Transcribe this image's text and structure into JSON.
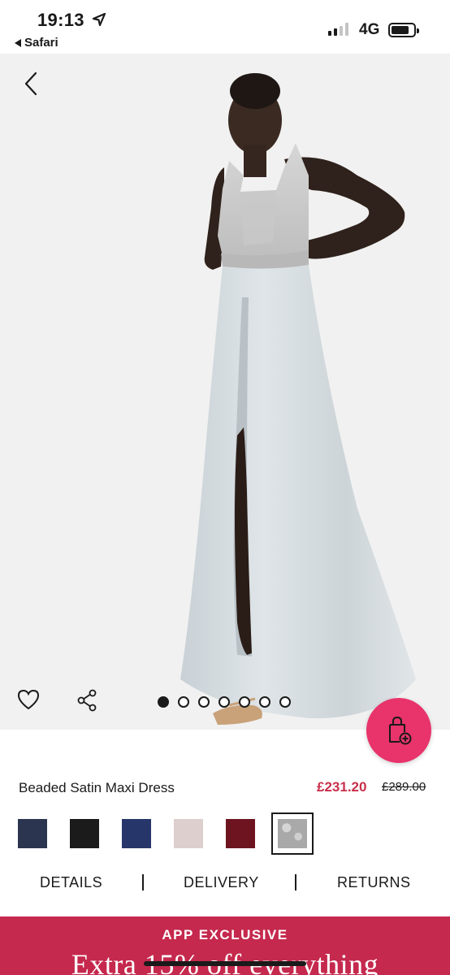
{
  "status_bar": {
    "time": "19:13",
    "back_app": "Safari",
    "network": "4G"
  },
  "product": {
    "title": "Beaded Satin Maxi Dress",
    "price_now": "£231.20",
    "price_was": "£289.00",
    "carousel": {
      "total_images": 7,
      "active_index": 0
    }
  },
  "swatches": [
    {
      "name": "navy-sequin",
      "color": "#2b3550",
      "selected": false
    },
    {
      "name": "black-sequin",
      "color": "#1b1b1b",
      "selected": false
    },
    {
      "name": "navy",
      "color": "#27366a",
      "selected": false
    },
    {
      "name": "blush",
      "color": "#dccfcd",
      "selected": false
    },
    {
      "name": "burgundy",
      "color": "#6d1420",
      "selected": false
    },
    {
      "name": "silver",
      "color": "#a9a9a9",
      "selected": true
    }
  ],
  "tabs": [
    "DETAILS",
    "DELIVERY",
    "RETURNS"
  ],
  "promo": {
    "kicker": "APP EXCLUSIVE",
    "headline": "Extra 15% off everything"
  },
  "colors": {
    "accent": "#e8336b",
    "sale_price": "#c8304b",
    "promo_bg": "#c5294d"
  }
}
